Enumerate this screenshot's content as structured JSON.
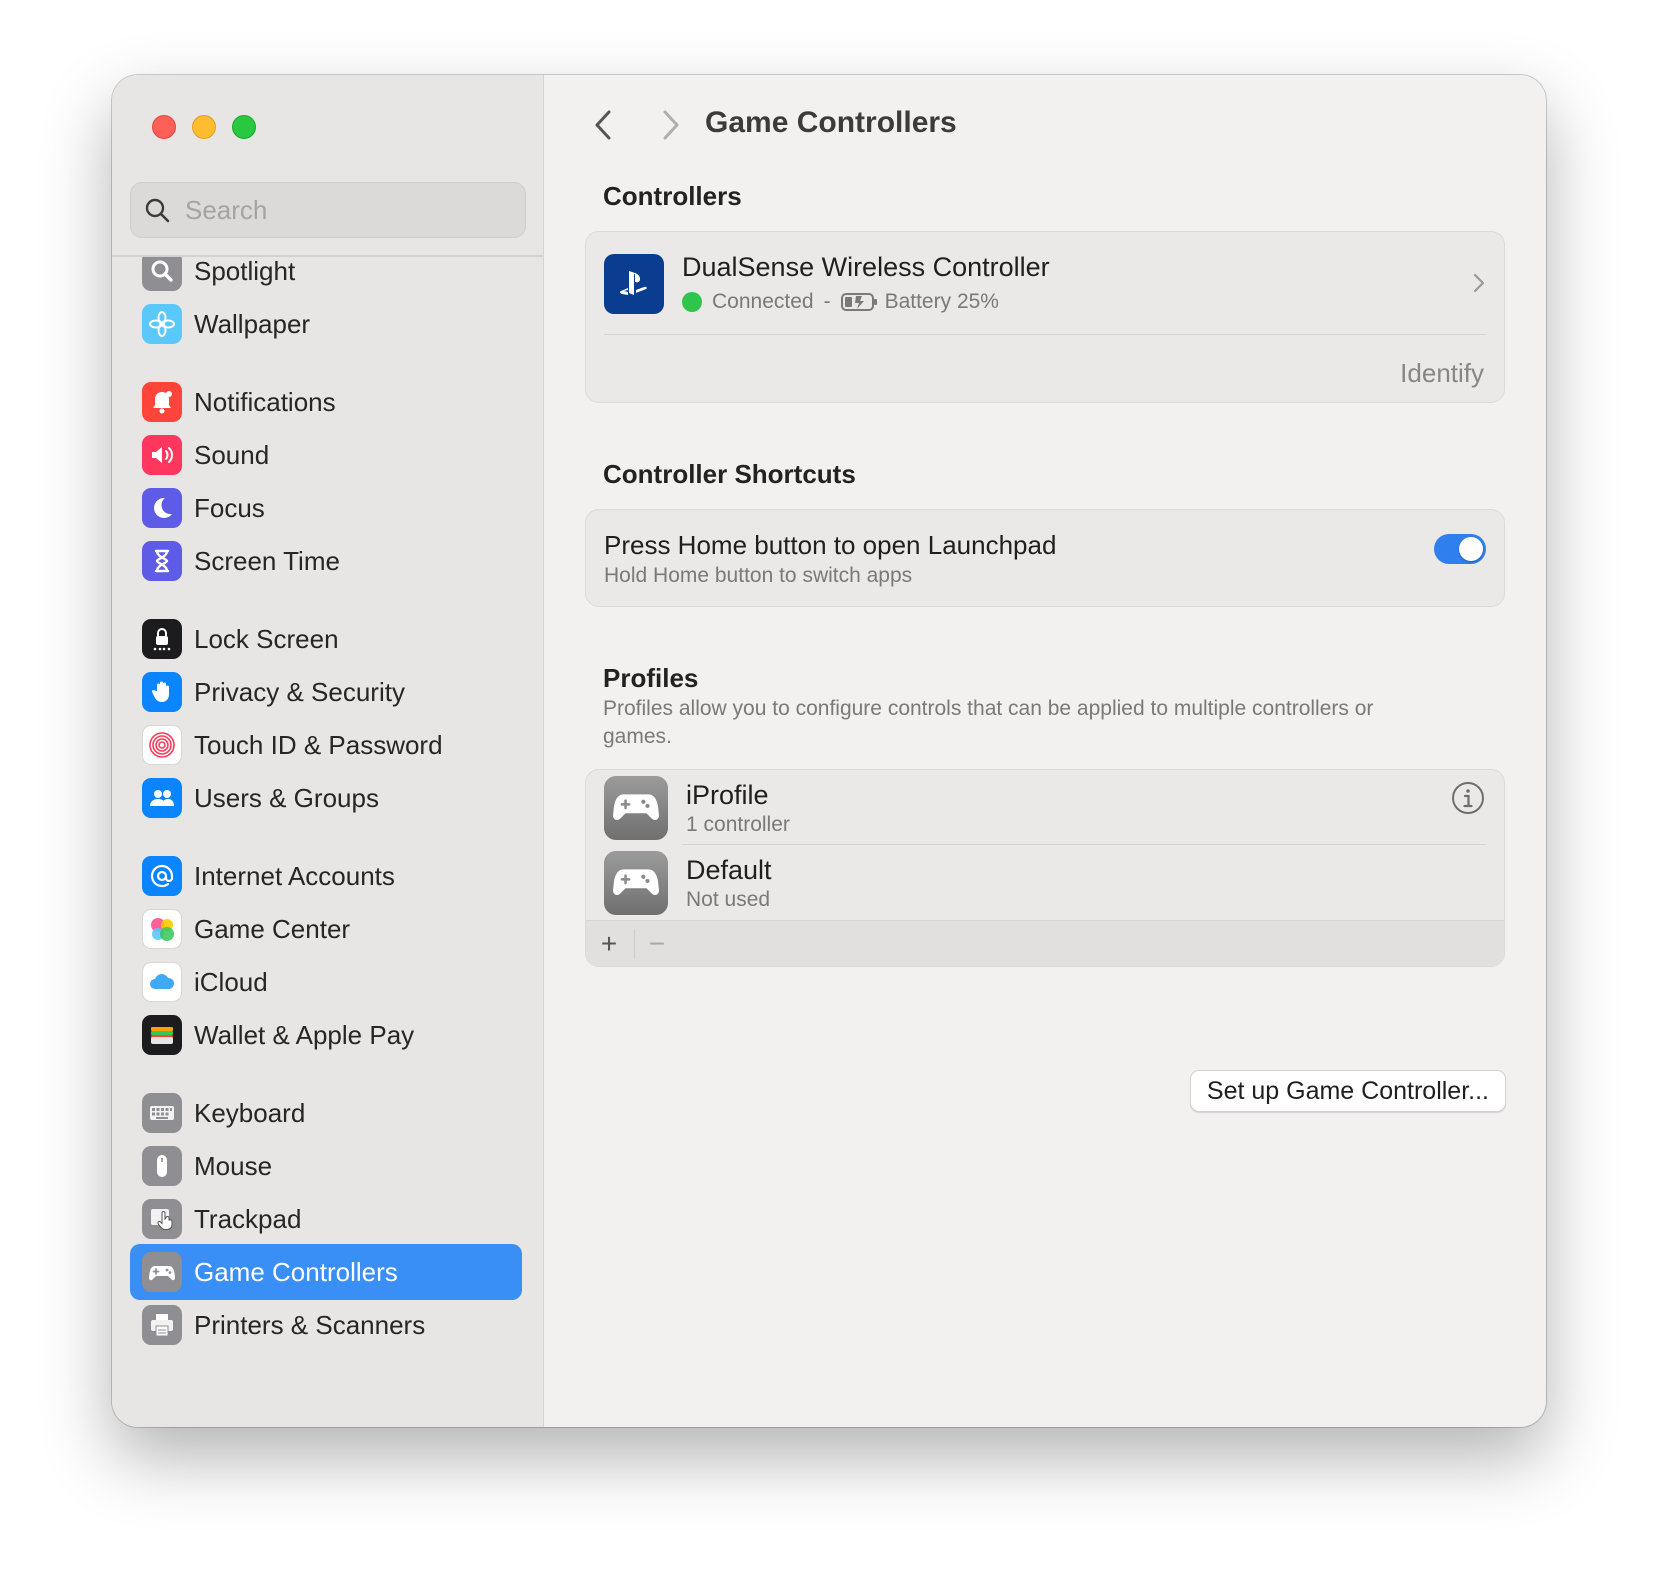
{
  "window": {
    "traffic_lights": [
      "close",
      "minimize",
      "zoom"
    ]
  },
  "search": {
    "placeholder": "Search"
  },
  "sidebar": {
    "items": [
      {
        "label": "Spotlight",
        "icon": "spotlight-icon",
        "color": "#8e8e93"
      },
      {
        "label": "Wallpaper",
        "icon": "wallpaper-icon",
        "color": "#5ac8fa"
      },
      {
        "label": "Notifications",
        "icon": "notifications-icon",
        "color": "#ff3b30"
      },
      {
        "label": "Sound",
        "icon": "sound-icon",
        "color": "#ff2d55"
      },
      {
        "label": "Focus",
        "icon": "focus-icon",
        "color": "#5e5ce6"
      },
      {
        "label": "Screen Time",
        "icon": "screen-time-icon",
        "color": "#5e5ce6"
      },
      {
        "label": "Lock Screen",
        "icon": "lock-screen-icon",
        "color": "#1c1c1e"
      },
      {
        "label": "Privacy & Security",
        "icon": "privacy-hand-icon",
        "color": "#0a84ff"
      },
      {
        "label": "Touch ID & Password",
        "icon": "fingerprint-icon",
        "color": "#ffffff"
      },
      {
        "label": "Users & Groups",
        "icon": "users-icon",
        "color": "#0a84ff"
      },
      {
        "label": "Internet Accounts",
        "icon": "at-sign-icon",
        "color": "#0a84ff"
      },
      {
        "label": "Game Center",
        "icon": "game-center-icon",
        "color": "#ffffff"
      },
      {
        "label": "iCloud",
        "icon": "icloud-icon",
        "color": "#ffffff"
      },
      {
        "label": "Wallet & Apple Pay",
        "icon": "wallet-icon",
        "color": "#1c1c1e"
      },
      {
        "label": "Keyboard",
        "icon": "keyboard-icon",
        "color": "#8e8e93"
      },
      {
        "label": "Mouse",
        "icon": "mouse-icon",
        "color": "#8e8e93"
      },
      {
        "label": "Trackpad",
        "icon": "trackpad-icon",
        "color": "#8e8e93"
      },
      {
        "label": "Game Controllers",
        "icon": "gamepad-icon",
        "color": "#8e8e93",
        "selected": true
      },
      {
        "label": "Printers & Scanners",
        "icon": "printer-icon",
        "color": "#8e8e93"
      }
    ]
  },
  "header": {
    "title": "Game Controllers"
  },
  "controllers": {
    "section_title": "Controllers",
    "device": {
      "name": "DualSense Wireless Controller",
      "status": "Connected",
      "separator": "-",
      "battery": "Battery 25%"
    },
    "identify_label": "Identify"
  },
  "shortcuts": {
    "section_title": "Controller Shortcuts",
    "title": "Press Home button to open Launchpad",
    "subtitle": "Hold Home button to switch apps",
    "enabled": true
  },
  "profiles": {
    "section_title": "Profiles",
    "description": "Profiles allow you to configure controls that can be applied to multiple controllers or games.",
    "items": [
      {
        "name": "iProfile",
        "sub": "1 controller"
      },
      {
        "name": "Default",
        "sub": "Not used"
      }
    ],
    "add_label": "+",
    "remove_label": "−"
  },
  "setup_button": {
    "label": "Set up Game Controller..."
  },
  "colors": {
    "accent": "#3a8ff7",
    "toggle_on": "#2f80ee",
    "status_green": "#2fc44b"
  }
}
